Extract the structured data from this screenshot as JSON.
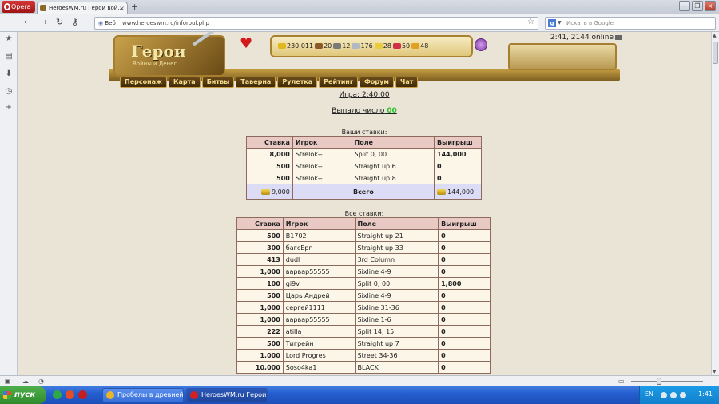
{
  "browser": {
    "opera_label": "Opera",
    "tab_title": "HeroesWM.ru Герои вой...",
    "address_label": "Веб",
    "url": "www.heroeswm.ru/inforoul.php",
    "search_placeholder": "Искать в Google"
  },
  "header": {
    "logo_title": "Герои",
    "logo_subtitle": "Войны и Денег",
    "online_status": "2:41, 2144 online",
    "resources": [
      {
        "icon": "gold-icon",
        "value": "230,011",
        "color": "#e0b820"
      },
      {
        "icon": "wood-icon",
        "value": "20",
        "color": "#8a5a2a"
      },
      {
        "icon": "ore-icon",
        "value": "12",
        "color": "#7a7a7a"
      },
      {
        "icon": "mercury-icon",
        "value": "176",
        "color": "#b0b8c4"
      },
      {
        "icon": "sulfur-icon",
        "value": "28",
        "color": "#e8cc3a"
      },
      {
        "icon": "crystal-icon",
        "value": "50",
        "color": "#d0304a"
      },
      {
        "icon": "gems-icon",
        "value": "48",
        "color": "#e0a020"
      }
    ]
  },
  "menu": {
    "items": [
      "Персонаж",
      "Карта",
      "Битвы",
      "Таверна",
      "Рулетка",
      "Рейтинг",
      "Форум",
      "Чат"
    ]
  },
  "game": {
    "game_time": "Игра: 2:40:00",
    "rolled_label": "Выпало число",
    "rolled_number": "00"
  },
  "my_bets": {
    "caption": "Ваши ставки:",
    "headers": [
      "Ставка",
      "Игрок",
      "Поле",
      "Выигрыш"
    ],
    "rows": [
      {
        "amount": "8,000",
        "player": "Strelok--",
        "field": "Split 0, 00",
        "win": "144,000"
      },
      {
        "amount": "500",
        "player": "Strelok--",
        "field": "Straight up 6",
        "win": "0"
      },
      {
        "amount": "500",
        "player": "Strelok--",
        "field": "Straight up 8",
        "win": "0"
      }
    ],
    "total_amount": "9,000",
    "total_label": "Всего",
    "total_win": "144,000"
  },
  "all_bets": {
    "caption": "Все ставки:",
    "headers": [
      "Ставка",
      "Игрок",
      "Поле",
      "Выигрыш"
    ],
    "rows": [
      {
        "amount": "500",
        "player": "B1702",
        "field": "Straight up 21",
        "win": "0"
      },
      {
        "amount": "300",
        "player": "багсЕрг",
        "field": "Straight up 33",
        "win": "0"
      },
      {
        "amount": "413",
        "player": "dudl",
        "field": "3rd Column",
        "win": "0"
      },
      {
        "amount": "1,000",
        "player": "варвар55555",
        "field": "Sixline 4-9",
        "win": "0"
      },
      {
        "amount": "100",
        "player": "gi9v",
        "field": "Split 0, 00",
        "win": "1,800"
      },
      {
        "amount": "500",
        "player": "Царь Андрей",
        "field": "Sixline 4-9",
        "win": "0"
      },
      {
        "amount": "1,000",
        "player": "сергей1111",
        "field": "Sixline 31-36",
        "win": "0"
      },
      {
        "amount": "1,000",
        "player": "варвар55555",
        "field": "Sixline 1-6",
        "win": "0"
      },
      {
        "amount": "222",
        "player": "atilla_",
        "field": "Split 14, 15",
        "win": "0"
      },
      {
        "amount": "500",
        "player": "Тигрейн",
        "field": "Straight up 7",
        "win": "0"
      },
      {
        "amount": "1,000",
        "player": "Lord Progres",
        "field": "Street 34-36",
        "win": "0"
      },
      {
        "amount": "10,000",
        "player": "Soso4ka1",
        "field": "BLACK",
        "win": "0"
      }
    ]
  },
  "taskbar": {
    "start_label": "пуск",
    "items": [
      "Пробелы в древней ...",
      "HeroesWM.ru Герои ..."
    ],
    "language": "EN",
    "clock": "1:41"
  }
}
